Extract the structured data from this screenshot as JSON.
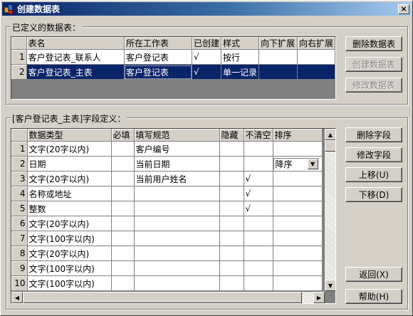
{
  "window": {
    "title": "创建数据表",
    "close_glyph": "×"
  },
  "tables_group": {
    "label": "已定义的数据表：",
    "columns": [
      "表名",
      "所在工作表",
      "已创建",
      "样式",
      "向下扩展",
      "向右扩展"
    ],
    "rows": [
      {
        "num": "1",
        "cells": [
          "客户登记表_联系人",
          "客户登记表",
          "√",
          "按行",
          "",
          ""
        ]
      },
      {
        "num": "2",
        "cells": [
          "客户登记表_主表",
          "客户登记表",
          "√",
          "单一记录",
          "",
          ""
        ]
      }
    ],
    "selected_row": 1,
    "buttons": {
      "delete": "删除数据表",
      "create": "创建数据表",
      "modify": "修改数据表"
    }
  },
  "fields_group": {
    "label": "[客户登记表_主表]字段定义：",
    "columns": [
      "数据类型",
      "必填",
      "填写规范",
      "隐藏",
      "不清空",
      "排序"
    ],
    "rows": [
      {
        "num": "1",
        "cells": [
          "文字(20字以内)",
          "",
          "客户编号",
          "",
          "",
          ""
        ]
      },
      {
        "num": "2",
        "cells": [
          "日期",
          "",
          "当前日期",
          "",
          "",
          ""
        ]
      },
      {
        "num": "3",
        "cells": [
          "文字(20字以内)",
          "",
          "当前用户姓名",
          "",
          "√",
          ""
        ]
      },
      {
        "num": "4",
        "cells": [
          "名称或地址",
          "",
          "",
          "",
          "√",
          ""
        ]
      },
      {
        "num": "5",
        "cells": [
          "整数",
          "",
          "",
          "",
          "√",
          ""
        ]
      },
      {
        "num": "6",
        "cells": [
          "文字(20字以内)",
          "",
          "",
          "",
          "",
          ""
        ]
      },
      {
        "num": "7",
        "cells": [
          "文字(100字以内)",
          "",
          "",
          "",
          "",
          ""
        ]
      },
      {
        "num": "8",
        "cells": [
          "文字(20字以内)",
          "",
          "",
          "",
          "",
          ""
        ]
      },
      {
        "num": "9",
        "cells": [
          "文字(100字以内)",
          "",
          "",
          "",
          "",
          ""
        ]
      },
      {
        "num": "10",
        "cells": [
          "文字(100字以内)",
          "",
          "",
          "",
          "",
          ""
        ]
      }
    ],
    "sort_dropdown": {
      "row": 2,
      "value": "降序"
    },
    "buttons": {
      "delete_field": "删除字段",
      "modify_field": "修改字段",
      "move_up": "上移(U)",
      "move_down": "下移(D)",
      "back": "返回(X)",
      "help": "帮助(H)"
    }
  }
}
